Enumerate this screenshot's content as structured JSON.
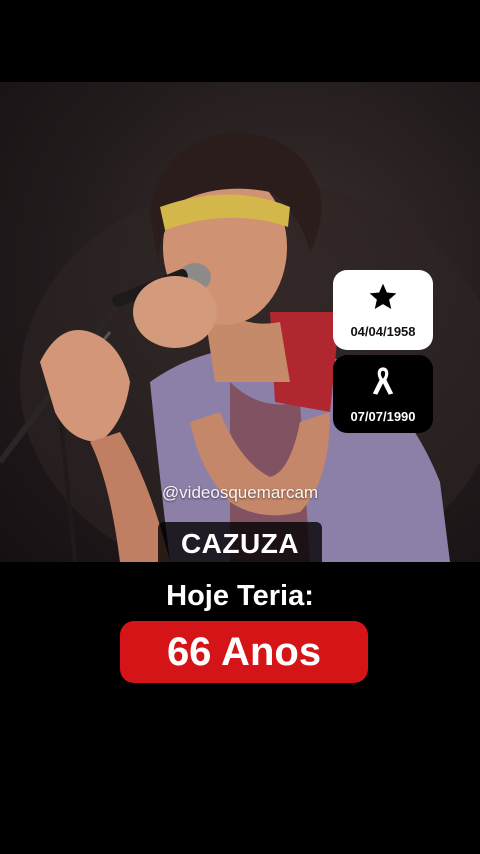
{
  "photo": {
    "subject": "singer-performing-with-microphone"
  },
  "cards": {
    "birth": {
      "icon": "star-icon",
      "date": "04/04/1958"
    },
    "death": {
      "icon": "mourning-ribbon-icon",
      "date": "07/07/1990"
    }
  },
  "watermark": "@videosquemarcam",
  "name": "CAZUZA",
  "subtitle": "Hoje Teria:",
  "age": "66 Anos",
  "colors": {
    "background": "#000000",
    "accent": "#d51418",
    "text": "#ffffff"
  }
}
